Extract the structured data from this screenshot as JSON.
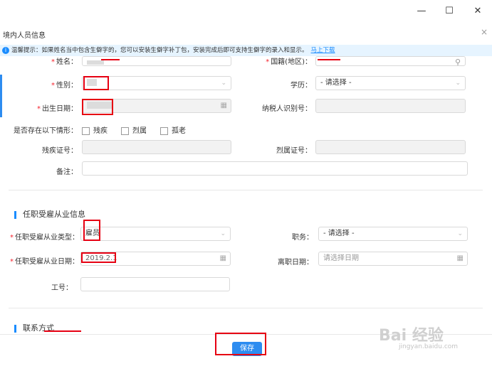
{
  "window": {
    "minimize": "—",
    "maximize": "☐",
    "close": "✕"
  },
  "dialog": {
    "title": "境内人员信息",
    "close": "×"
  },
  "tip": {
    "text": "温馨提示：如果姓名当中包含生僻字的，您可以安装生僻字补丁包，安装完成后即可支持生僻字的录入和显示。",
    "link": "马上下载"
  },
  "basic": {
    "name_label": "姓名：",
    "nationality_label": "国籍(地区)：",
    "gender_label": "性别：",
    "education_label": "学历：",
    "education_value": "- 请选择 -",
    "birth_label": "出生日期：",
    "taxid_label": "纳税人识别号：",
    "situation_label": "是否存在以下情形：",
    "situations": [
      "残疾",
      "烈属",
      "孤老"
    ],
    "disability_label": "残疾证号：",
    "martyr_label": "烈属证号：",
    "remark_label": "备注："
  },
  "employment": {
    "section_title": "任职受雇从业信息",
    "type_label": "任职受雇从业类型：",
    "type_value": "雇员",
    "position_label": "职务：",
    "position_value": "- 请选择 -",
    "start_label": "任职受雇从业日期：",
    "start_value": "2019.2.1",
    "leave_label": "离职日期：",
    "leave_placeholder": "请选择日期",
    "staff_label": "工号："
  },
  "contact": {
    "section_title": "联系方式"
  },
  "footer": {
    "save": "保存"
  },
  "watermark": {
    "main": "Bai 经验",
    "sub": "jingyan.baidu.com"
  },
  "colors": {
    "accent": "#2d8cf0",
    "annotation": "#e60012",
    "tip_bg": "#e6f4ff"
  },
  "icons": {
    "dropdown": "chevron-down-icon",
    "date": "calendar-icon",
    "search": "search-icon",
    "tip": "info-icon"
  }
}
